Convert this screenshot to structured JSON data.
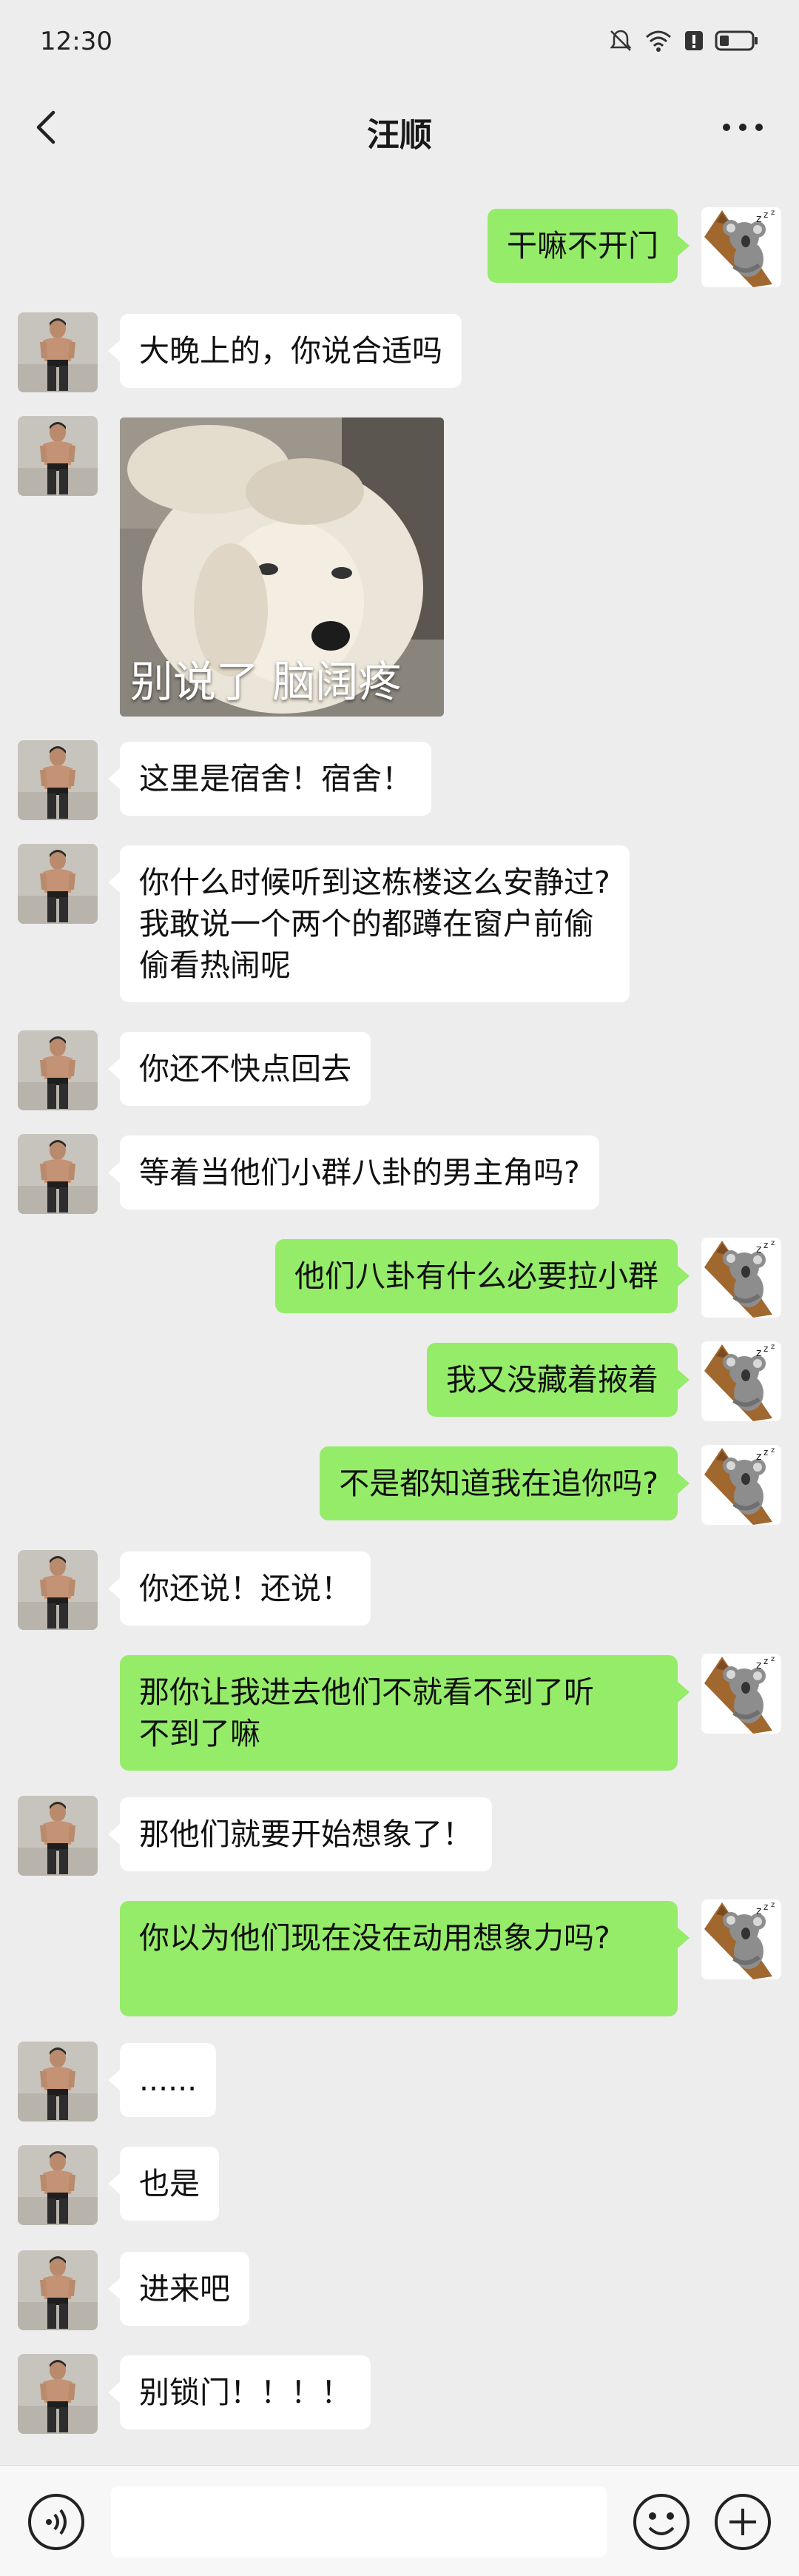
{
  "status": {
    "time": "12:30"
  },
  "header": {
    "title": "汪顺"
  },
  "messages": [
    {
      "side": "right",
      "text": "干嘛不开门"
    },
    {
      "side": "left",
      "text": "大晚上的，你说合适吗"
    },
    {
      "side": "left",
      "type": "image",
      "caption": "别说了 脑阔疼"
    },
    {
      "side": "left",
      "text": "这里是宿舍！宿舍！"
    },
    {
      "side": "left",
      "text": "你什么时候听到这栋楼这么安静过?\n我敢说一个两个的都蹲在窗户前偷\n偷看热闹呢"
    },
    {
      "side": "left",
      "text": "你还不快点回去"
    },
    {
      "side": "left",
      "text": "等着当他们小群八卦的男主角吗?"
    },
    {
      "side": "right",
      "text": "他们八卦有什么必要拉小群"
    },
    {
      "side": "right",
      "text": "我又没藏着掖着"
    },
    {
      "side": "right",
      "text": "不是都知道我在追你吗?"
    },
    {
      "side": "left",
      "text": "你还说！还说！"
    },
    {
      "side": "right",
      "text": "那你让我进去他们不就看不到了听\n不到了嘛"
    },
    {
      "side": "left",
      "text": "那他们就要开始想象了！"
    },
    {
      "side": "right",
      "text": "你以为他们现在没在动用想象力吗?\n"
    },
    {
      "side": "left",
      "text": "......"
    },
    {
      "side": "left",
      "text": "也是"
    },
    {
      "side": "left",
      "text": "进来吧"
    },
    {
      "side": "left",
      "text": "别锁门！！！！"
    }
  ],
  "input": {
    "placeholder": ""
  },
  "colors": {
    "bg": "#ededed",
    "sent": "#95ec69",
    "received": "#ffffff"
  }
}
